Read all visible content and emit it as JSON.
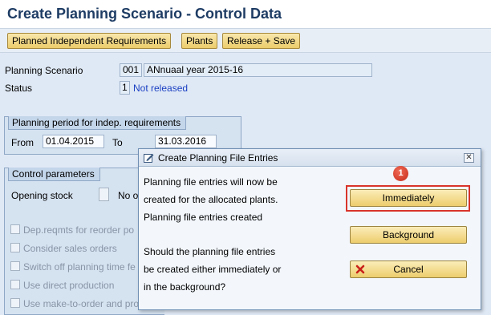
{
  "page_title": "Create Planning Scenario - Control Data",
  "toolbar": {
    "pir_label": "Planned Independent Requirements",
    "plants_label": "Plants",
    "release_save_label": "Release + Save"
  },
  "form": {
    "planning_scenario_label": "Planning Scenario",
    "planning_scenario_code": "001",
    "planning_scenario_desc": "ANnuaal year 2015-16",
    "status_label": "Status",
    "status_code": "1",
    "status_text": "Not released"
  },
  "planning_period": {
    "title": "Planning period for indep. requirements",
    "from_label": "From",
    "from_value": "01.04.2015",
    "to_label": "To",
    "to_value": "31.03.2016"
  },
  "control_parameters": {
    "title": "Control parameters",
    "opening_stock_label": "Opening stock",
    "opening_stock_option_partial": "No o",
    "checkboxes": [
      {
        "label": "Dep.reqmts for reorder po",
        "checked": false
      },
      {
        "label": "Consider sales orders",
        "checked": false
      },
      {
        "label": "Switch off planning time fe",
        "checked": false
      },
      {
        "label": "Use direct production",
        "checked": false
      },
      {
        "label": "Use make-to-order and project planning",
        "checked": false
      }
    ]
  },
  "dialog": {
    "title": "Create Planning File Entries",
    "text_line1": "Planning file entries will now be",
    "text_line2": "created for the allocated plants.",
    "text_line3": "Planning file entries created",
    "question_line1": "Should the planning file entries",
    "question_line2": "be created either immediately or",
    "question_line3": "in the background?",
    "immediately_label": "Immediately",
    "background_label": "Background",
    "cancel_label": "Cancel",
    "step_badge": "1"
  },
  "colors": {
    "title_text": "#1e3c64",
    "button_gold": "#edcd6d",
    "highlight_red": "#d9342b",
    "status_blue": "#1a3fc2",
    "background": "#dfe9f5"
  },
  "icons": {
    "dialog_icon": "edit-window-icon",
    "close_icon": "close-icon",
    "cancel_icon": "red-x-icon"
  }
}
